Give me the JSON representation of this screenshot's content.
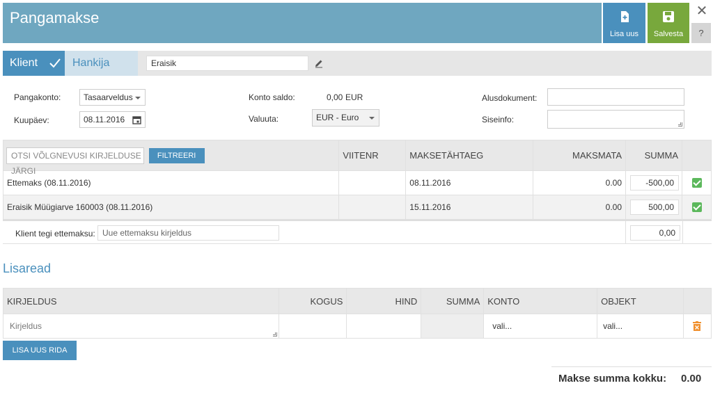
{
  "header": {
    "title": "Pangamakse",
    "add_new_label": "Lisa uus",
    "save_label": "Salvesta",
    "close_glyph": "✕",
    "help_glyph": "?"
  },
  "tabs": {
    "klient_label": "Klient",
    "hankija_label": "Hankija",
    "partner_name": "Eraisik"
  },
  "form": {
    "pangakonto_label": "Pangakonto:",
    "pangakonto_value": "Tasaarveldus",
    "kuupaev_label": "Kuupäev:",
    "kuupaev_value": "08.11.2016",
    "konto_saldo_label": "Konto saldo:",
    "konto_saldo_value": "0,00",
    "konto_saldo_currency": "EUR",
    "valuuta_label": "Valuuta:",
    "valuuta_value": "EUR - Euro",
    "alusdokument_label": "Alusdokument:",
    "siseinfo_label": "Siseinfo:"
  },
  "debts": {
    "search_placeholder": "Otsi võlgnevusi kirjelduse järgi",
    "filter_label": "FILTREERI",
    "columns": {
      "viitenr": "VIITENR",
      "maksetahtaeg": "MAKSETÄHTAEG",
      "maksmata": "MAKSMATA",
      "summa": "SUMMA"
    },
    "rows": [
      {
        "desc": "Ettemaks (08.11.2016)",
        "viitenr": "",
        "due": "08.11.2016",
        "unpaid": "0.00",
        "amount": "-500,00"
      },
      {
        "desc": "Eraisik Müügiarve 160003 (08.11.2016)",
        "viitenr": "",
        "due": "15.11.2016",
        "unpaid": "0.00",
        "amount": "500,00"
      }
    ],
    "prepay_label": "Klient tegi ettemaksu:",
    "prepay_placeholder": "Uue ettemaksu kirjeldus",
    "prepay_amount": "0,00"
  },
  "extra": {
    "title": "Lisaread",
    "columns": {
      "kirjeldus": "KIRJELDUS",
      "kogus": "KOGUS",
      "hind": "HIND",
      "summa": "SUMMA",
      "konto": "KONTO",
      "objekt": "OBJEKT"
    },
    "row": {
      "desc_placeholder": "Kirjeldus",
      "konto": "vali...",
      "objekt": "vali..."
    },
    "add_row_label": "LISA UUS RIDA"
  },
  "total": {
    "label": "Makse summa kokku:",
    "value": "0.00"
  },
  "colors": {
    "header_bg": "#6fa7c0",
    "accent_blue": "#4a90bd",
    "save_green": "#78a83c",
    "check_green": "#5cb85c",
    "delete_orange": "#f0902e"
  }
}
